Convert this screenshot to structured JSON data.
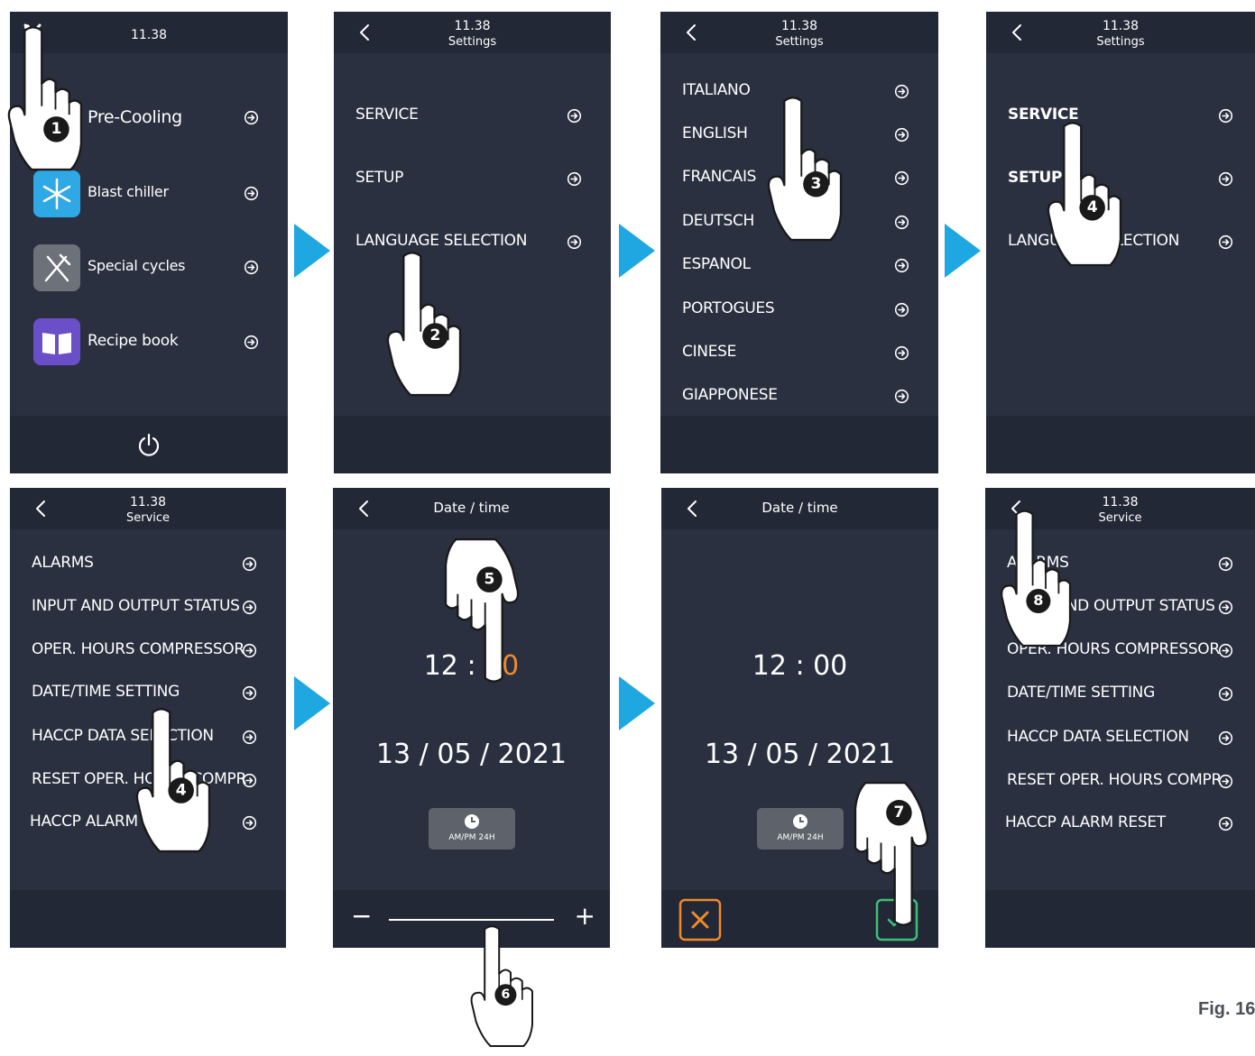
{
  "time": "11.38",
  "screen1": {
    "items": [
      {
        "label": "Pre-Cooling",
        "icon": "none"
      },
      {
        "label": "Blast chiller",
        "icon": "snowflake-icon"
      },
      {
        "label": "Special cycles",
        "icon": "utensils-icon"
      },
      {
        "label": "Recipe book",
        "icon": "book-icon"
      }
    ],
    "tools_icon": "tools-icon",
    "power_icon": "power-icon"
  },
  "screen2": {
    "subtitle": "Settings",
    "items": [
      "SERVICE",
      "SETUP",
      "LANGUAGE SELECTION"
    ]
  },
  "screen3": {
    "subtitle": "Settings",
    "items": [
      "ITALIANO",
      "ENGLISH",
      "FRANCAIS",
      "DEUTSCH",
      "ESPANOL",
      "PORTOGUES",
      "CINESE",
      "GIAPPONESE"
    ]
  },
  "screen4": {
    "subtitle": "Settings",
    "items": [
      "SERVICE",
      "SETUP",
      "LANGUAGE SELECTION"
    ]
  },
  "screen5": {
    "subtitle": "Service",
    "items": [
      "ALARMS",
      "INPUT AND OUTPUT STATUS",
      "OPER. HOURS COMPRESSOR",
      "DATE/TIME SETTING",
      "HACCP DATA SELECTION",
      "RESET OPER. HOURS COMPR",
      "HACCP ALARM RESET"
    ]
  },
  "screen6": {
    "title": "Date / time",
    "hours": "12",
    "colon": ":",
    "minutes": "00",
    "date": "13 / 05 / 2021",
    "clock_label": "AM/PM 24H",
    "minus": "−",
    "plus": "+"
  },
  "screen7": {
    "title": "Date / time",
    "time_value": "12 : 00",
    "date": "13 / 05 / 2021",
    "clock_label": "AM/PM 24H"
  },
  "screen8": {
    "subtitle": "Service",
    "items": [
      "ALARMS",
      "INPUT AND OUTPUT STATUS",
      "OPER. HOURS COMPRESSOR",
      "DATE/TIME SETTING",
      "HACCP DATA SELECTION",
      "RESET OPER. HOURS COMPR",
      "HACCP ALARM RESET"
    ]
  },
  "steps": [
    "1",
    "2",
    "3",
    "4",
    "4",
    "5",
    "6",
    "7",
    "8"
  ],
  "figure_label": "Fig. 16",
  "colors": {
    "screen_bg": "#2a303f",
    "bar_bg": "#222835",
    "arrow_blue": "#1ea7e1",
    "highlight_orange": "#f08a2c",
    "confirm_green": "#3dbf7a"
  }
}
